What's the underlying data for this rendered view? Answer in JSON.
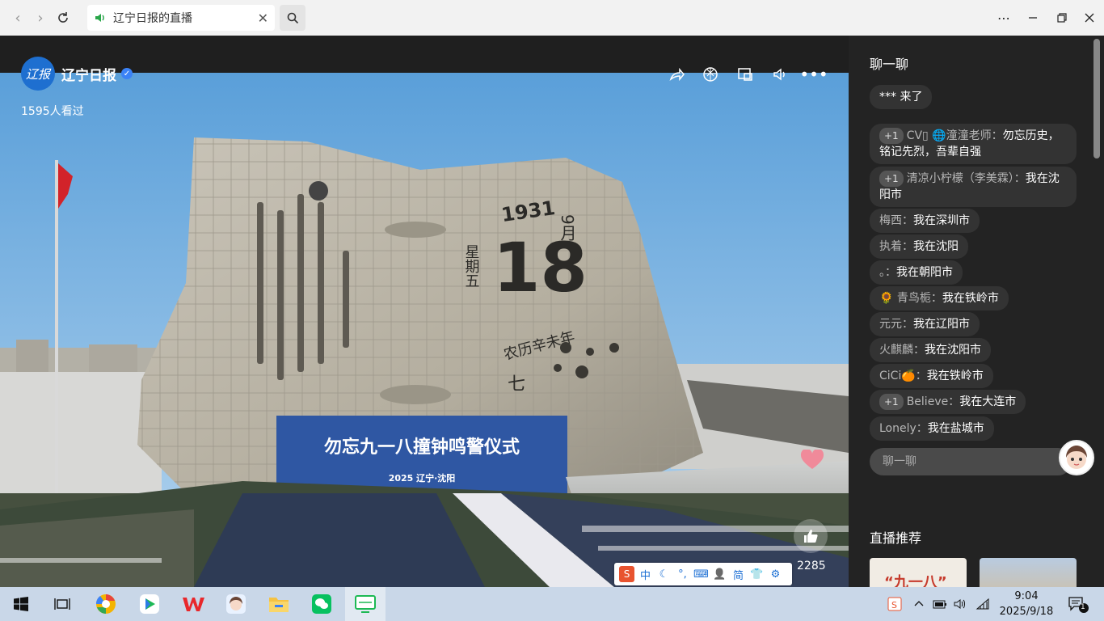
{
  "browser": {
    "tab_title": "辽宁日报的直播",
    "close_glyph": "✕"
  },
  "video": {
    "channel_name": "辽宁日报",
    "logo_text": "辽报",
    "viewers": "1595人看过",
    "banner_title": "勿忘九一八撞钟鸣警仪式",
    "banner_subtitle": "2025  辽宁·沈阳",
    "monument": {
      "year": "1931",
      "day": "18",
      "month": "9月",
      "weekday": "星期五",
      "lunar": "农历辛未年",
      "lunar_day": "七"
    },
    "like_count": "2285"
  },
  "ime": {
    "items": [
      "中",
      "☾",
      "°,",
      "⌨",
      "👤",
      "简",
      "👕",
      "⚙"
    ]
  },
  "chat": {
    "title": "聊一聊",
    "messages": [
      {
        "badge": "",
        "name": "",
        "text": "*** 来了"
      },
      {
        "badge": "+1",
        "name": "CV▯ 🌐潼潼老师：",
        "text": "勿忘历史，铭记先烈，吾辈自强"
      },
      {
        "badge": "+1",
        "name": "清凉小柠檬（李美霖）：",
        "text": "我在沈阳市"
      },
      {
        "badge": "",
        "name": "梅西：",
        "text": "我在深圳市"
      },
      {
        "badge": "",
        "name": "执着：",
        "text": "我在沈阳"
      },
      {
        "badge": "",
        "name": "。：",
        "text": "我在朝阳市"
      },
      {
        "badge": "",
        "name": "🌻 青鸟栀：",
        "text": "我在铁岭市"
      },
      {
        "badge": "",
        "name": "元元：",
        "text": "我在辽阳市"
      },
      {
        "badge": "",
        "name": "火麒麟：",
        "text": "我在沈阳市"
      },
      {
        "badge": "",
        "name": "CiCi🍊：",
        "text": "我在铁岭市"
      },
      {
        "badge": "+1",
        "name": "Believe：",
        "text": "我在大连市"
      },
      {
        "badge": "",
        "name": "Lonely：",
        "text": "我在盐城市"
      }
    ],
    "input_placeholder": "聊一聊",
    "recommend_title": "直播推荐"
  },
  "taskbar": {
    "time": "9:04",
    "date": "2025/9/18",
    "notification_count": "1"
  }
}
